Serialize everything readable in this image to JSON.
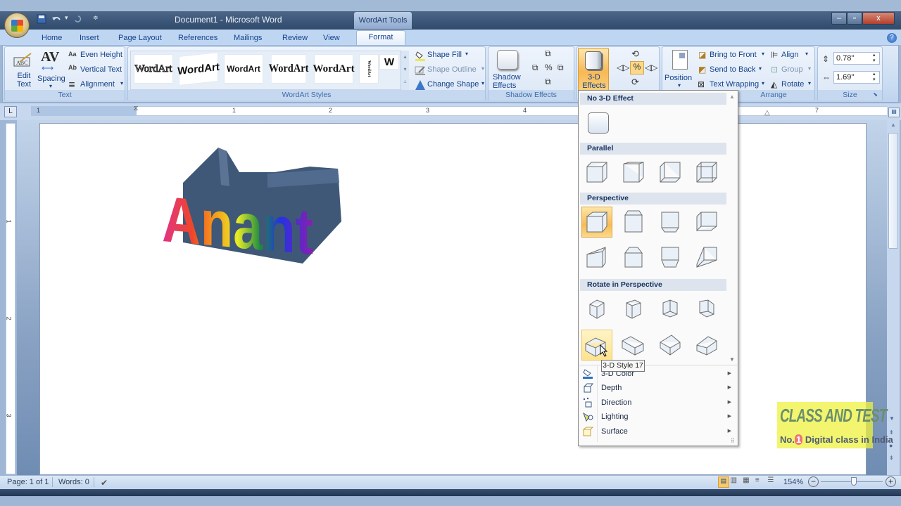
{
  "window": {
    "title": "Document1 - Microsoft Word",
    "contextual_tab_group": "WordArt Tools",
    "quick_access": [
      "save-icon",
      "undo-icon",
      "redo-icon",
      "customize-icon"
    ],
    "controls": {
      "minimize": "–",
      "restore": "▫",
      "close": "x"
    }
  },
  "tabs": [
    {
      "label": "Home"
    },
    {
      "label": "Insert"
    },
    {
      "label": "Page Layout"
    },
    {
      "label": "References"
    },
    {
      "label": "Mailings"
    },
    {
      "label": "Review"
    },
    {
      "label": "View"
    },
    {
      "label": "Format",
      "active": true
    }
  ],
  "help_glyph": "?",
  "ribbon": {
    "text_group": {
      "label": "Text",
      "edit_text": "Edit Text",
      "spacing": "Spacing",
      "even_height": "Even Height",
      "vertical_text": "Vertical Text",
      "alignment": "Alignment"
    },
    "wordart_styles": {
      "label": "WordArt Styles",
      "gallery": [
        "WordArt",
        "WordArt",
        "WordArt",
        "WordArt",
        "WordArt",
        "W"
      ],
      "shape_fill": "Shape Fill",
      "shape_outline": "Shape Outline",
      "change_shape": "Change Shape"
    },
    "shadow_effects": {
      "label": "Shadow Effects",
      "button": "Shadow Effects"
    },
    "effects_3d": {
      "button": "3-D Effects"
    },
    "arrange": {
      "label": "Arrange",
      "position": "Position",
      "bring_to_front": "Bring to Front",
      "send_to_back": "Send to Back",
      "text_wrapping": "Text Wrapping",
      "align": "Align",
      "group": "Group",
      "rotate": "Rotate"
    },
    "size": {
      "label": "Size",
      "height": "0.78\"",
      "width": "1.69\""
    }
  },
  "ruler": {
    "corner": "L",
    "h_numbers": [
      "1",
      "1",
      "2",
      "3",
      "4",
      "7"
    ],
    "v_numbers": [
      "1",
      "2",
      "3"
    ]
  },
  "document": {
    "wordart_text": "Anant"
  },
  "menu_3d": {
    "sections": [
      {
        "title": "No 3-D Effect"
      },
      {
        "title": "Parallel"
      },
      {
        "title": "Perspective"
      },
      {
        "title": "Rotate in Perspective"
      }
    ],
    "tooltip": "3-D Style 17",
    "items": [
      {
        "label": "3-D Color",
        "icon": "paint-bucket-icon"
      },
      {
        "label": "Depth",
        "icon": "depth-icon"
      },
      {
        "label": "Direction",
        "icon": "direction-icon"
      },
      {
        "label": "Lighting",
        "icon": "lighting-icon"
      },
      {
        "label": "Surface",
        "icon": "surface-icon"
      }
    ]
  },
  "status": {
    "page": "Page: 1 of 1",
    "words": "Words: 0",
    "zoom": "154%"
  },
  "watermark": {
    "line1": "CLASS AND TEST",
    "line2a": "No.",
    "line2num": "1",
    "line2b": "Digital class in India"
  },
  "colors": {
    "accent_orange": "#f7bb55",
    "ribbon_text": "#15428b",
    "wordart_side": "#3f5877"
  }
}
